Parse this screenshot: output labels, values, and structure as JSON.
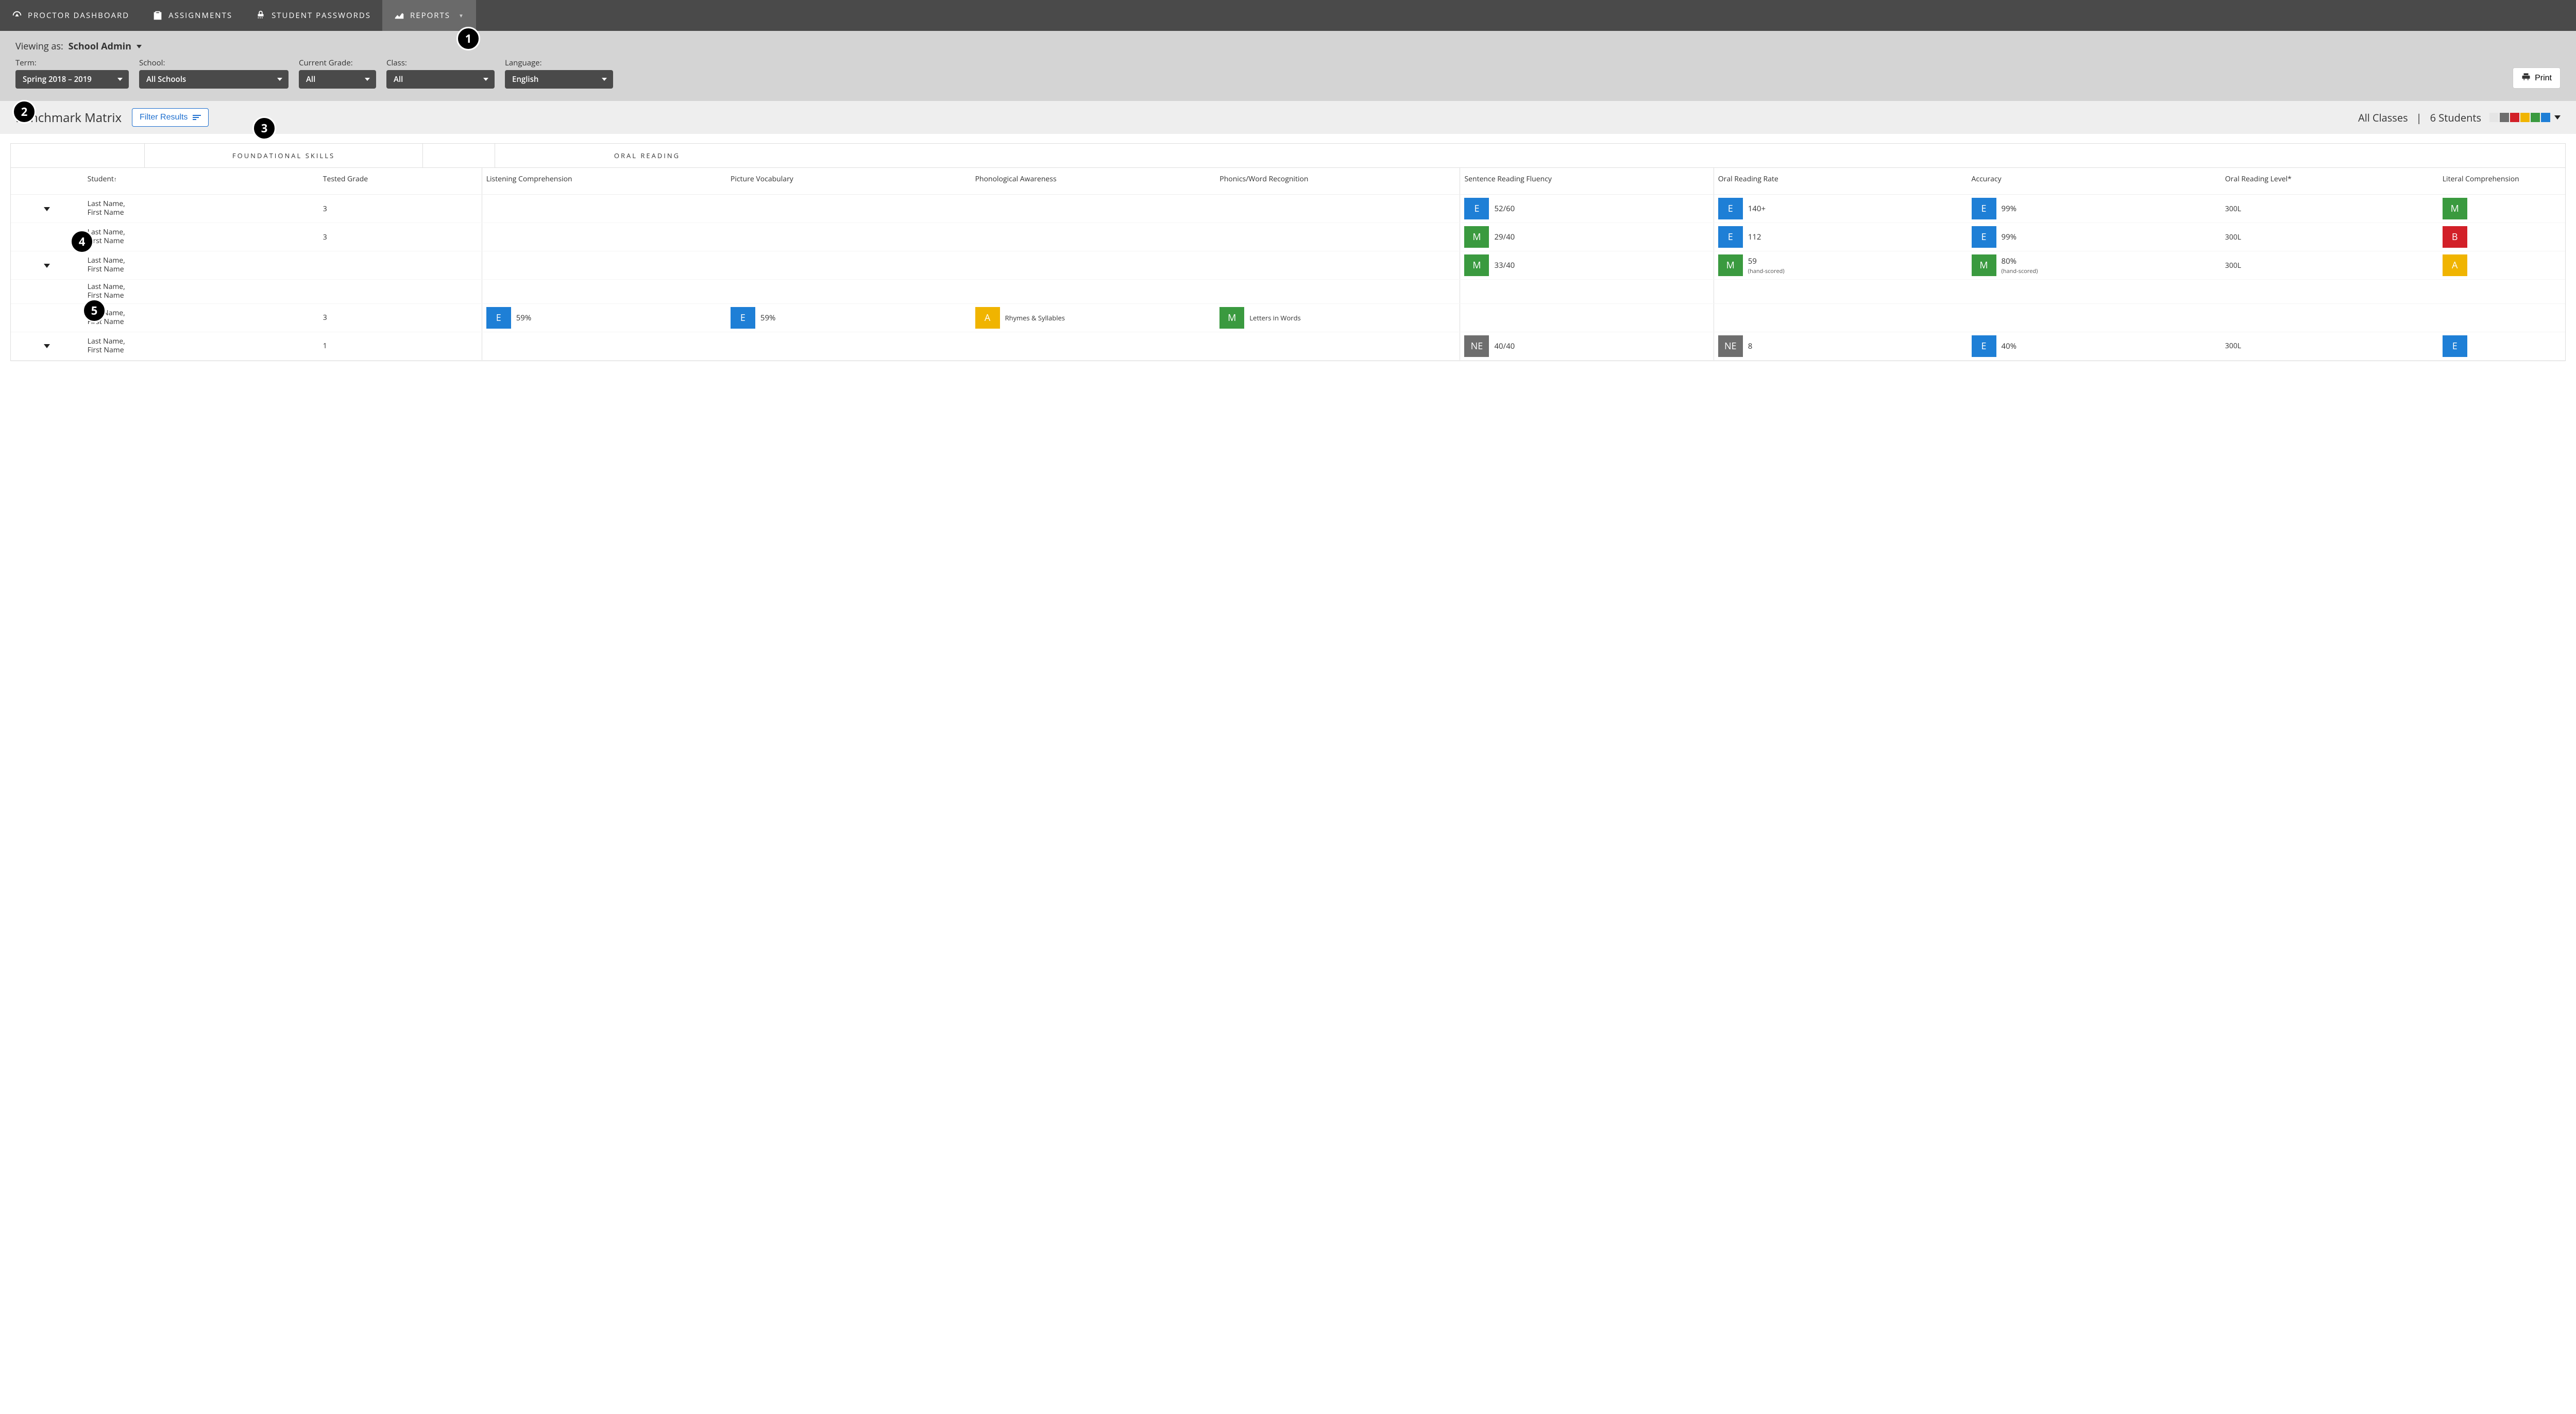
{
  "nav": {
    "items": [
      {
        "label": "PROCTOR DASHBOARD",
        "icon": "gauge"
      },
      {
        "label": "ASSIGNMENTS",
        "icon": "clipboard"
      },
      {
        "label": "STUDENT PASSWORDS",
        "icon": "lock"
      },
      {
        "label": "REPORTS",
        "icon": "chart",
        "active": true,
        "dropdown": true
      }
    ]
  },
  "viewing_as": {
    "prefix": "Viewing as:",
    "role": "School Admin"
  },
  "filters": {
    "term": {
      "label": "Term:",
      "value": "Spring 2018 – 2019"
    },
    "school": {
      "label": "School:",
      "value": "All Schools"
    },
    "grade": {
      "label": "Current Grade:",
      "value": "All"
    },
    "class": {
      "label": "Class:",
      "value": "All"
    },
    "lang": {
      "label": "Language:",
      "value": "English"
    }
  },
  "print_label": "Print",
  "page_title": "Benchmark Matrix",
  "filter_results_label": "Filter Results",
  "summary": {
    "classes": "All Classes",
    "sep": "|",
    "students": "6 Students"
  },
  "legend_colors": [
    "#e5e5e5",
    "#6e6e6e",
    "#d22028",
    "#f0b400",
    "#3a9a3f",
    "#1e7fd6"
  ],
  "groups": {
    "foundational": "FOUNDATIONAL SKILLS",
    "oral": "ORAL READING"
  },
  "columns": {
    "student": "Student",
    "tested_grade": "Tested Grade",
    "listening": "Listening Comprehension",
    "picture": "Picture Vocabulary",
    "phonological": "Phonological Awareness",
    "phonics": "Phonics/Word Recognition",
    "srf": "Sentence Reading Fluency",
    "orr": "Oral Reading Rate",
    "accuracy": "Accuracy",
    "orl": "Oral Reading Level*",
    "literal": "Literal Comprehension"
  },
  "rows": [
    {
      "expandable": true,
      "name": "Last Name, First Name",
      "grade": "3",
      "srf": {
        "badge": "E",
        "val": "52/60"
      },
      "orr": {
        "badge": "E",
        "val": "140+"
      },
      "acc": {
        "badge": "E",
        "val": "99%"
      },
      "orl": "300L",
      "lit": {
        "badge": "M"
      }
    },
    {
      "expandable": false,
      "name": "Last Name, First Name",
      "grade": "3",
      "srf": {
        "badge": "M",
        "val": "29/40"
      },
      "orr": {
        "badge": "E",
        "val": "112"
      },
      "acc": {
        "badge": "E",
        "val": "99%"
      },
      "orl": "300L",
      "lit": {
        "badge": "B"
      }
    },
    {
      "expandable": true,
      "name": "Last Name, First Name",
      "grade": "",
      "srf": {
        "badge": "M",
        "val": "33/40"
      },
      "orr": {
        "badge": "M",
        "val": "59",
        "sub": "(hand-scored)"
      },
      "acc": {
        "badge": "M",
        "val": "80%",
        "sub": "(hand-scored)"
      },
      "orl": "300L",
      "lit": {
        "badge": "A"
      }
    },
    {
      "expandable": false,
      "name": "Last Name, First Name",
      "grade": ""
    },
    {
      "expandable": false,
      "name": "Last Name, First Name",
      "grade": "3",
      "listening": {
        "badge": "E",
        "val": "59%"
      },
      "picture": {
        "badge": "E",
        "val": "59%"
      },
      "phonological": {
        "badge": "A",
        "val": "Rhymes & Syllables"
      },
      "phonics": {
        "badge": "M",
        "val": "Letters in Words"
      }
    },
    {
      "expandable": true,
      "name": "Last Name, First Name",
      "grade": "1",
      "srf": {
        "badge": "NE",
        "val": "40/40"
      },
      "orr": {
        "badge": "NE",
        "val": "8"
      },
      "acc": {
        "badge": "E",
        "val": "40%"
      },
      "orl": "300L",
      "lit": {
        "badge": "E"
      }
    }
  ],
  "callouts": {
    "1": "1",
    "2": "2",
    "3": "3",
    "4": "4",
    "5": "5"
  }
}
